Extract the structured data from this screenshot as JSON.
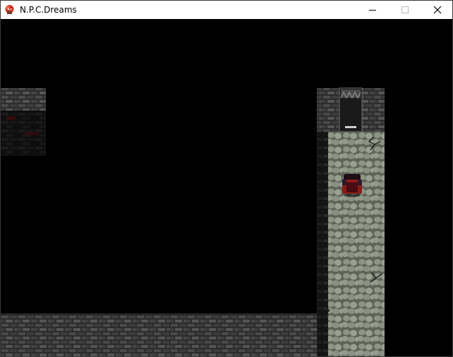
{
  "window": {
    "title": "N.P.C.Dreams",
    "buttons": {
      "minimize": "minimize-icon",
      "maximize": "maximize-icon",
      "close": "close-icon"
    }
  },
  "scene": {
    "background_color": "#000000",
    "wall_color": "#3b3b3b",
    "floor_color": "#8c9384",
    "door_color": "#1a1a1a",
    "player_color": "#8b1a1a",
    "crack_icon": "crack-icon"
  }
}
